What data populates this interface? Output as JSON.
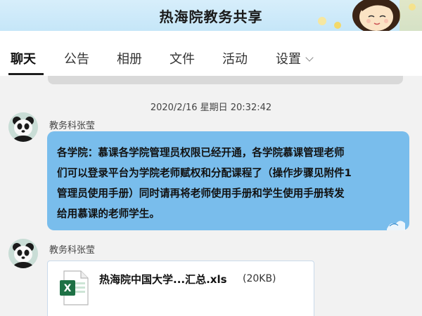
{
  "header": {
    "title": "热海院教务共享"
  },
  "tabs": [
    {
      "label": "聊天"
    },
    {
      "label": "公告"
    },
    {
      "label": "相册"
    },
    {
      "label": "文件"
    },
    {
      "label": "活动"
    },
    {
      "label": "设置"
    }
  ],
  "chat": {
    "timestamp": "2020/2/16 星期日 20:32:42",
    "messages": [
      {
        "sender": "教务科张莹",
        "text": "各学院：慕课各学院管理员权限已经开通，各学院慕课管理老师\n们可以登录平台为学院老师赋权和分配课程了（操作步骤见附件1\n管理员使用手册）同时请再将老师使用手册和学生使用手册转发\n给用慕课的老师学生。"
      },
      {
        "sender": "教务科张莹",
        "file": {
          "name": "热海院中国大学...汇总.xls",
          "size": "(20KB)",
          "icon": "excel-icon"
        }
      }
    ]
  },
  "colors": {
    "bubble": "#79bdec",
    "header_bg": "#c5e6f8",
    "excel_green": "#1e7145"
  }
}
